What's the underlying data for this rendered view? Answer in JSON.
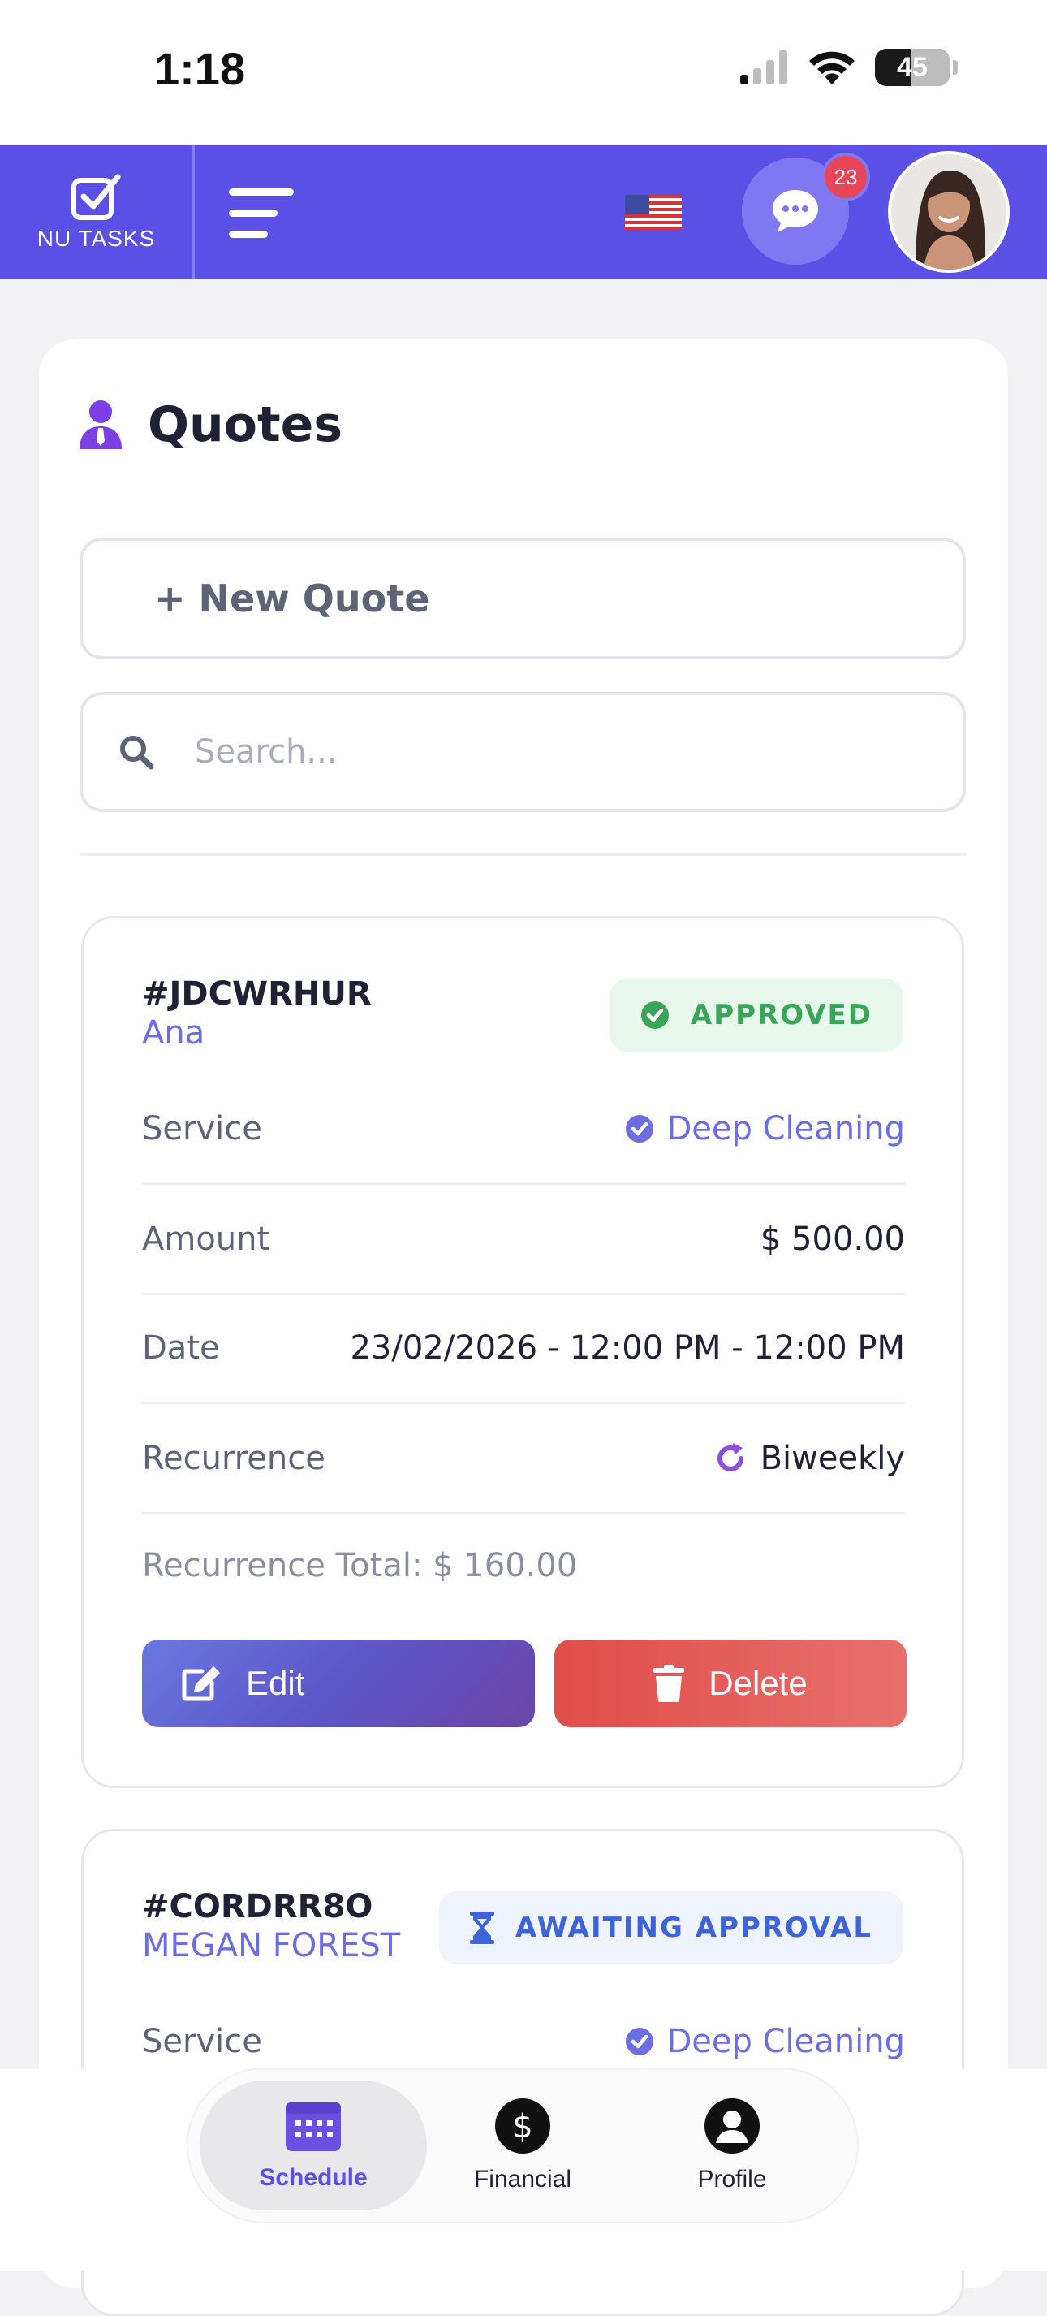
{
  "status_bar": {
    "time": "1:18",
    "battery": "45"
  },
  "app_bar": {
    "logo_text": "NU TASKS",
    "chat_badge": "23"
  },
  "page": {
    "title": "Quotes",
    "new_quote_label": "+ New Quote",
    "search_placeholder": "Search..."
  },
  "quotes": [
    {
      "id": "#JDCWRHUR",
      "client": "Ana",
      "status": "APPROVED",
      "service_label": "Service",
      "service_value": "Deep Cleaning",
      "amount_label": "Amount",
      "amount_value": "$ 500.00",
      "date_label": "Date",
      "date_value": "23/02/2026 - 12:00 PM - 12:00 PM",
      "recurrence_label": "Recurrence",
      "recurrence_value": "Biweekly",
      "recurrence_total": "Recurrence Total: $ 160.00",
      "edit_label": "Edit",
      "delete_label": "Delete"
    },
    {
      "id": "#CORDRR8O",
      "client": "MEGAN FOREST",
      "status": "AWAITING APPROVAL",
      "service_label": "Service",
      "service_value": "Deep Cleaning"
    }
  ],
  "bottom_nav": [
    {
      "label": "Schedule",
      "icon": "calendar-icon",
      "active": true
    },
    {
      "label": "Financial",
      "icon": "dollar-icon",
      "active": false
    },
    {
      "label": "Profile",
      "icon": "user-icon",
      "active": false
    }
  ],
  "colors": {
    "brand": "#5b50e6",
    "approved": "#3aa55a",
    "awaiting": "#3d63d8",
    "link": "#6b6ee0",
    "delete": "#df4d4a"
  }
}
